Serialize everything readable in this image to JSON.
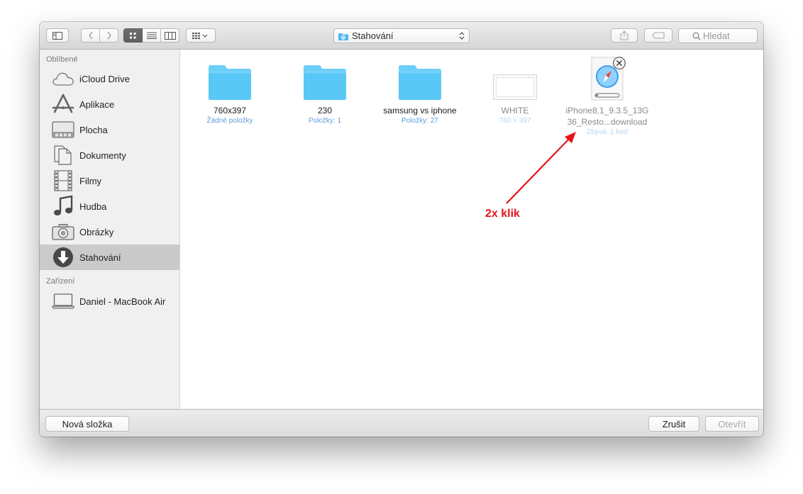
{
  "toolbar": {
    "path_label": "Stahování",
    "search_placeholder": "Hledat",
    "icons": {
      "sidebar_toggle": "sidebar-toggle-icon",
      "back": "chevron-left-icon",
      "forward": "chevron-right-icon",
      "icon_view": "icon-view-icon",
      "list_view": "list-view-icon",
      "column_view": "column-view-icon",
      "arrange": "arrange-icon",
      "share": "share-icon",
      "tag": "tag-icon",
      "search": "search-icon"
    }
  },
  "sidebar": {
    "favorites_header": "Oblíbené",
    "favorites": [
      {
        "label": "iCloud Drive",
        "icon": "cloud-icon"
      },
      {
        "label": "Aplikace",
        "icon": "applications-icon"
      },
      {
        "label": "Plocha",
        "icon": "desktop-icon"
      },
      {
        "label": "Dokumenty",
        "icon": "documents-icon"
      },
      {
        "label": "Filmy",
        "icon": "film-icon"
      },
      {
        "label": "Hudba",
        "icon": "music-note-icon"
      },
      {
        "label": "Obrázky",
        "icon": "camera-icon"
      },
      {
        "label": "Stahování",
        "icon": "download-icon",
        "selected": true
      }
    ],
    "devices_header": "Zařízení",
    "devices": [
      {
        "label": "Daniel - MacBook Air",
        "icon": "laptop-icon"
      }
    ]
  },
  "content": {
    "items": [
      {
        "name": "760x397",
        "sub": "Žádné položky",
        "kind": "folder"
      },
      {
        "name": "230",
        "sub": "Položky: 1",
        "kind": "folder"
      },
      {
        "name": "samsung vs iphone",
        "sub": "Položky: 27",
        "kind": "folder"
      },
      {
        "name": "WHITE",
        "sub": "760 × 397",
        "kind": "image"
      },
      {
        "name_line1": "iPhone8,1_9.3.5_13G",
        "name_line2": "36_Resto...download",
        "sub": "Zbývá: 1 hod",
        "kind": "download"
      }
    ]
  },
  "annotation": {
    "text": "2x klik",
    "color": "#e5141a"
  },
  "bottombar": {
    "new_folder": "Nová složka",
    "cancel": "Zrušit",
    "open": "Otevřít"
  },
  "colors": {
    "folder_blue": "#5ac8f7",
    "selection_gray": "#cacaca",
    "annotation_red": "#e5141a"
  }
}
